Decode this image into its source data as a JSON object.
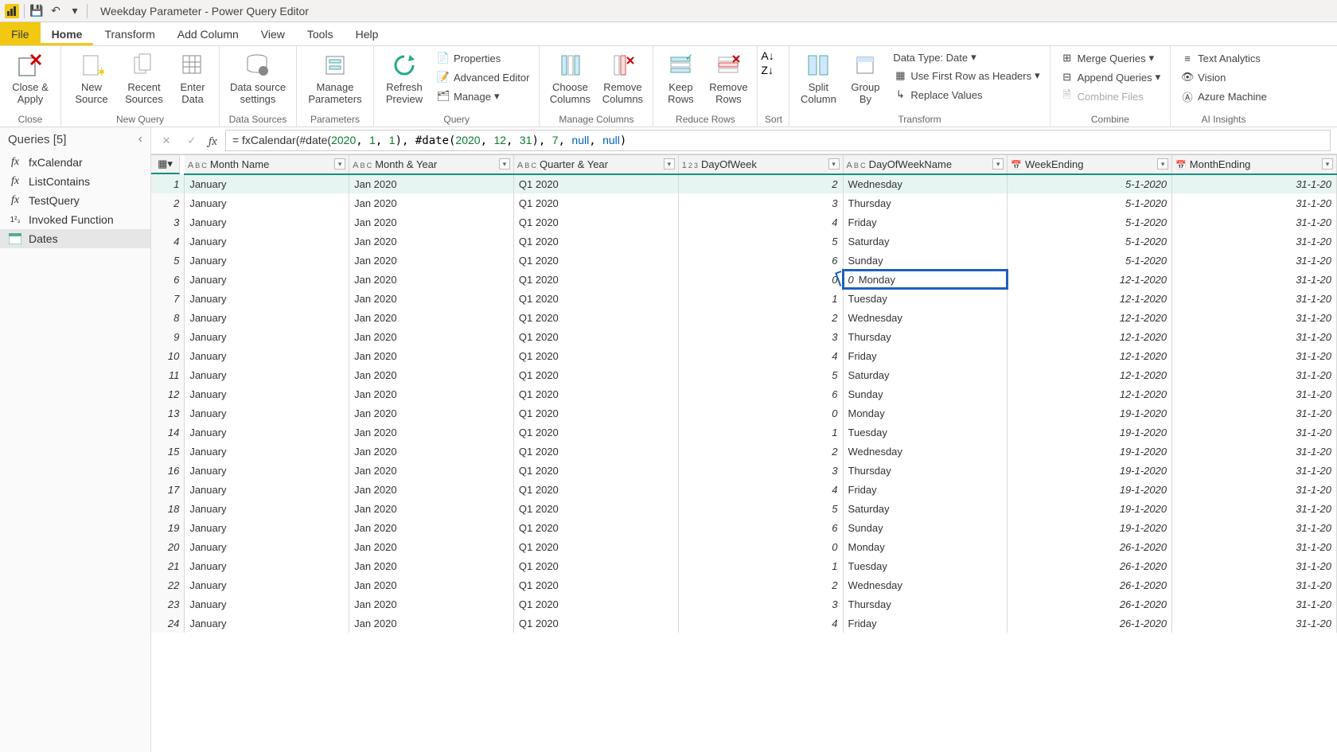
{
  "titlebar": {
    "title": "Weekday Parameter - Power Query Editor"
  },
  "menubar": {
    "file": "File",
    "tabs": [
      "Home",
      "Transform",
      "Add Column",
      "View",
      "Tools",
      "Help"
    ],
    "active": 0
  },
  "ribbon": {
    "close": {
      "label": "Close &\nApply",
      "group": "Close"
    },
    "newquery": {
      "new_source": "New\nSource",
      "recent_sources": "Recent\nSources",
      "enter_data": "Enter\nData",
      "group": "New Query"
    },
    "datasources": {
      "settings": "Data source\nsettings",
      "group": "Data Sources"
    },
    "parameters": {
      "manage": "Manage\nParameters",
      "group": "Parameters"
    },
    "query": {
      "refresh": "Refresh\nPreview",
      "properties": "Properties",
      "advanced_editor": "Advanced Editor",
      "manage": "Manage",
      "group": "Query"
    },
    "manage_columns": {
      "choose": "Choose\nColumns",
      "remove": "Remove\nColumns",
      "group": "Manage Columns"
    },
    "reduce_rows": {
      "keep": "Keep\nRows",
      "remove": "Remove\nRows",
      "group": "Reduce Rows"
    },
    "sort": {
      "group": "Sort"
    },
    "transform": {
      "split": "Split\nColumn",
      "group_by": "Group\nBy",
      "data_type": "Data Type: Date",
      "first_row": "Use First Row as Headers",
      "replace": "Replace Values",
      "group": "Transform"
    },
    "combine": {
      "merge": "Merge Queries",
      "append": "Append Queries",
      "combine_files": "Combine Files",
      "group": "Combine"
    },
    "ai": {
      "text_analytics": "Text Analytics",
      "vision": "Vision",
      "azure_ml": "Azure Machine",
      "group": "AI Insights"
    }
  },
  "queries_panel": {
    "header": "Queries [5]",
    "items": [
      {
        "name": "fxCalendar",
        "kind": "fx"
      },
      {
        "name": "ListContains",
        "kind": "fx"
      },
      {
        "name": "TestQuery",
        "kind": "fx"
      },
      {
        "name": "Invoked Function",
        "kind": "num"
      },
      {
        "name": "Dates",
        "kind": "table",
        "selected": true
      }
    ]
  },
  "formula": {
    "prefix": "= fxCalendar(#date(",
    "d1y": "2020",
    "d1m": "1",
    "d1d": "1",
    "mid1": "), #date(",
    "d2y": "2020",
    "d2m": "12",
    "d2d": "31",
    "mid2": "), ",
    "arg3": "7",
    "mid3": ", ",
    "arg4": "null",
    "mid4": ", ",
    "arg5": "null",
    "suffix": ")"
  },
  "grid": {
    "columns": [
      {
        "name": "Month Name",
        "type": "ABC"
      },
      {
        "name": "Month & Year",
        "type": "ABC"
      },
      {
        "name": "Quarter & Year",
        "type": "ABC"
      },
      {
        "name": "DayOfWeek",
        "type": "123"
      },
      {
        "name": "DayOfWeekName",
        "type": "ABC"
      },
      {
        "name": "WeekEnding",
        "type": "DATE"
      },
      {
        "name": "MonthEnding",
        "type": "DATE"
      }
    ],
    "highlight": {
      "row": 6,
      "col": 4
    },
    "rows": [
      [
        "January",
        "Jan 2020",
        "Q1 2020",
        "2",
        "Wednesday",
        "5-1-2020",
        "31-1-20"
      ],
      [
        "January",
        "Jan 2020",
        "Q1 2020",
        "3",
        "Thursday",
        "5-1-2020",
        "31-1-20"
      ],
      [
        "January",
        "Jan 2020",
        "Q1 2020",
        "4",
        "Friday",
        "5-1-2020",
        "31-1-20"
      ],
      [
        "January",
        "Jan 2020",
        "Q1 2020",
        "5",
        "Saturday",
        "5-1-2020",
        "31-1-20"
      ],
      [
        "January",
        "Jan 2020",
        "Q1 2020",
        "6",
        "Sunday",
        "5-1-2020",
        "31-1-20"
      ],
      [
        "January",
        "Jan 2020",
        "Q1 2020",
        "0",
        "Monday",
        "12-1-2020",
        "31-1-20"
      ],
      [
        "January",
        "Jan 2020",
        "Q1 2020",
        "1",
        "Tuesday",
        "12-1-2020",
        "31-1-20"
      ],
      [
        "January",
        "Jan 2020",
        "Q1 2020",
        "2",
        "Wednesday",
        "12-1-2020",
        "31-1-20"
      ],
      [
        "January",
        "Jan 2020",
        "Q1 2020",
        "3",
        "Thursday",
        "12-1-2020",
        "31-1-20"
      ],
      [
        "January",
        "Jan 2020",
        "Q1 2020",
        "4",
        "Friday",
        "12-1-2020",
        "31-1-20"
      ],
      [
        "January",
        "Jan 2020",
        "Q1 2020",
        "5",
        "Saturday",
        "12-1-2020",
        "31-1-20"
      ],
      [
        "January",
        "Jan 2020",
        "Q1 2020",
        "6",
        "Sunday",
        "12-1-2020",
        "31-1-20"
      ],
      [
        "January",
        "Jan 2020",
        "Q1 2020",
        "0",
        "Monday",
        "19-1-2020",
        "31-1-20"
      ],
      [
        "January",
        "Jan 2020",
        "Q1 2020",
        "1",
        "Tuesday",
        "19-1-2020",
        "31-1-20"
      ],
      [
        "January",
        "Jan 2020",
        "Q1 2020",
        "2",
        "Wednesday",
        "19-1-2020",
        "31-1-20"
      ],
      [
        "January",
        "Jan 2020",
        "Q1 2020",
        "3",
        "Thursday",
        "19-1-2020",
        "31-1-20"
      ],
      [
        "January",
        "Jan 2020",
        "Q1 2020",
        "4",
        "Friday",
        "19-1-2020",
        "31-1-20"
      ],
      [
        "January",
        "Jan 2020",
        "Q1 2020",
        "5",
        "Saturday",
        "19-1-2020",
        "31-1-20"
      ],
      [
        "January",
        "Jan 2020",
        "Q1 2020",
        "6",
        "Sunday",
        "19-1-2020",
        "31-1-20"
      ],
      [
        "January",
        "Jan 2020",
        "Q1 2020",
        "0",
        "Monday",
        "26-1-2020",
        "31-1-20"
      ],
      [
        "January",
        "Jan 2020",
        "Q1 2020",
        "1",
        "Tuesday",
        "26-1-2020",
        "31-1-20"
      ],
      [
        "January",
        "Jan 2020",
        "Q1 2020",
        "2",
        "Wednesday",
        "26-1-2020",
        "31-1-20"
      ],
      [
        "January",
        "Jan 2020",
        "Q1 2020",
        "3",
        "Thursday",
        "26-1-2020",
        "31-1-20"
      ],
      [
        "January",
        "Jan 2020",
        "Q1 2020",
        "4",
        "Friday",
        "26-1-2020",
        "31-1-20"
      ]
    ]
  }
}
